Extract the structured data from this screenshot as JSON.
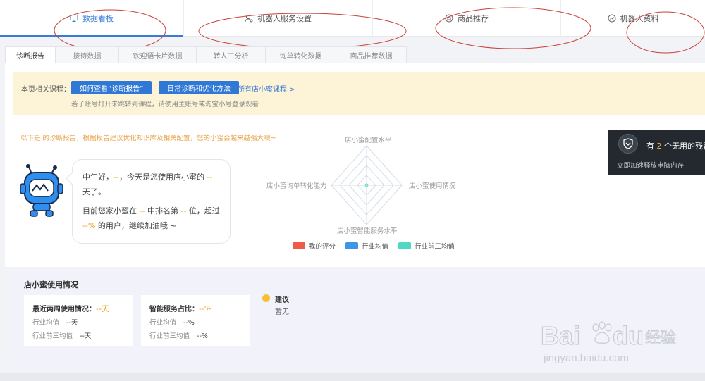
{
  "topnav": [
    {
      "label": "数据看板",
      "icon": "monitor-icon",
      "active": true
    },
    {
      "label": "机器人服务设置",
      "icon": "user-settings-icon",
      "active": false
    },
    {
      "label": "商品推荐",
      "icon": "product-icon",
      "active": false
    },
    {
      "label": "机器人资料",
      "icon": "robot-profile-icon",
      "active": false
    }
  ],
  "subtabs": [
    "诊断报告",
    "接待数据",
    "欢迎语卡片数据",
    "转人工分析",
    "询单转化数据",
    "商品推荐数据"
  ],
  "banner": {
    "label": "本页相关课程：",
    "btn1": "如何查看“诊断报告”",
    "btn2": "日常诊断和优化方法",
    "link": "所有店小蜜课程 >",
    "tip": "若子账号打开未跳转到课程，请使用主账号或淘宝小号登录观看"
  },
  "intro": "以下是 的诊断报告，根据报告建议优化知识库及相关配置，您的小蜜会越来越强大噢~",
  "bubble": {
    "greet_a": "中午好，",
    "dash1": "--",
    "greet_b": "，今天是您使用店小蜜的 ",
    "dash2": "--",
    "greet_c": "天了。",
    "rank_a": "目前您家小蜜在 ",
    "dash3": "--",
    "rank_b": " 中排名第 ",
    "dash4": "--",
    "rank_c": " 位，超过",
    "pct": "--%",
    "rank_d": " 的用户，继续加油哦 ~"
  },
  "radar": {
    "top": "店小蜜配置水平",
    "right": "店小蜜使用情况",
    "bottom": "店小蜜智能服务水平",
    "left": "店小蜜询单转化能力"
  },
  "legend": [
    {
      "label": "我的评分",
      "color": "#f05a46"
    },
    {
      "label": "行业均值",
      "color": "#3d95ea"
    },
    {
      "label": "行业前三均值",
      "color": "#4fd8c4"
    }
  ],
  "popup": {
    "pre": "有 ",
    "count": "2",
    "post": " 个无用的残留",
    "sub": "立即加速释放电脑内存"
  },
  "usage": {
    "title": "店小蜜使用情况",
    "card1": {
      "title": "最近两周使用情况：",
      "value": "--天",
      "r1l": "行业均值",
      "r1v": "--天",
      "r2l": "行业前三均值",
      "r2v": "--天"
    },
    "card2": {
      "title": "智能服务占比：",
      "value": "--%",
      "r1l": "行业均值",
      "r1v": "--%",
      "r2l": "行业前三均值",
      "r2v": "--%"
    },
    "advice": {
      "title": "建议",
      "value": "暂无"
    }
  },
  "watermark": {
    "brand": "Bai",
    "brand2": "du",
    "cn": "经验",
    "url": "jingyan.baidu.com"
  }
}
